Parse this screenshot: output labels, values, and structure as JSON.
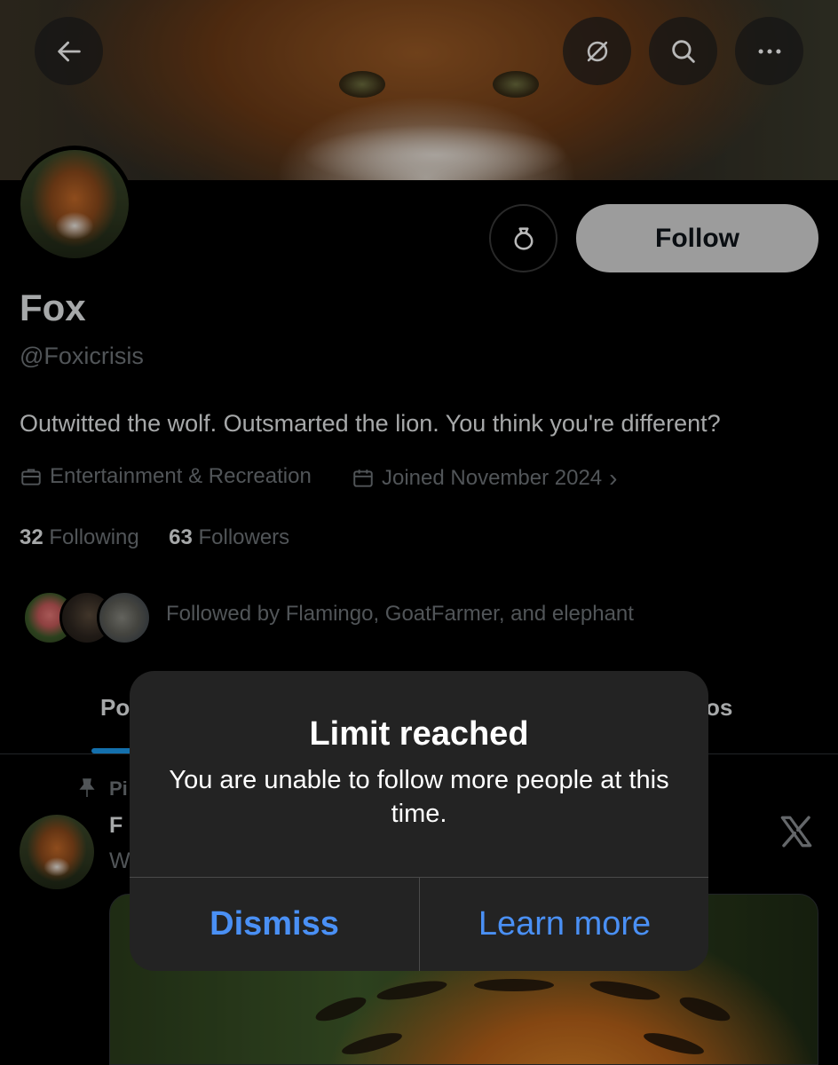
{
  "header": {
    "back_icon": "back-arrow-icon",
    "grok_icon": "grok-icon",
    "search_icon": "search-icon",
    "more_icon": "more-icon"
  },
  "profile": {
    "name": "Fox",
    "handle": "@Foxicrisis",
    "bio": "Outwitted the wolf. Outsmarted the lion. You think you're different?",
    "category": "Entertainment & Recreation",
    "joined": "Joined November 2024",
    "joined_chevron": "›",
    "following_count": "32",
    "following_label": "Following",
    "followers_count": "63",
    "followers_label": "Followers",
    "followed_by": "Followed by Flamingo, GoatFarmer, and elephant",
    "follow_label": "Follow"
  },
  "tabs": {
    "left_partial": "Po",
    "right_partial": "os"
  },
  "post": {
    "pinned_partial": "Pi",
    "name_partial": "F",
    "text_partial": "W"
  },
  "alert": {
    "title": "Limit reached",
    "message": "You are unable to follow more people at this time.",
    "dismiss_label": "Dismiss",
    "learn_more_label": "Learn more"
  },
  "colors": {
    "accent": "#1d9bf0",
    "alert_button": "#4a90f5",
    "muted_text": "#71767b"
  }
}
